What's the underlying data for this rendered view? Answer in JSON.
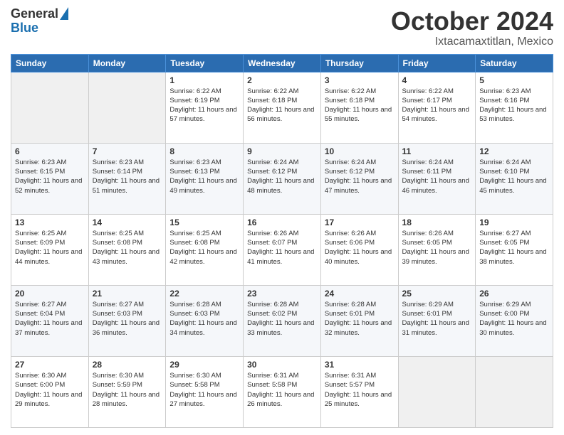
{
  "logo": {
    "general": "General",
    "blue": "Blue"
  },
  "header": {
    "month": "October 2024",
    "location": "Ixtacamaxtitlan, Mexico"
  },
  "weekdays": [
    "Sunday",
    "Monday",
    "Tuesday",
    "Wednesday",
    "Thursday",
    "Friday",
    "Saturday"
  ],
  "weeks": [
    [
      {
        "day": "",
        "sunrise": "",
        "sunset": "",
        "daylight": ""
      },
      {
        "day": "",
        "sunrise": "",
        "sunset": "",
        "daylight": ""
      },
      {
        "day": "1",
        "sunrise": "Sunrise: 6:22 AM",
        "sunset": "Sunset: 6:19 PM",
        "daylight": "Daylight: 11 hours and 57 minutes."
      },
      {
        "day": "2",
        "sunrise": "Sunrise: 6:22 AM",
        "sunset": "Sunset: 6:18 PM",
        "daylight": "Daylight: 11 hours and 56 minutes."
      },
      {
        "day": "3",
        "sunrise": "Sunrise: 6:22 AM",
        "sunset": "Sunset: 6:18 PM",
        "daylight": "Daylight: 11 hours and 55 minutes."
      },
      {
        "day": "4",
        "sunrise": "Sunrise: 6:22 AM",
        "sunset": "Sunset: 6:17 PM",
        "daylight": "Daylight: 11 hours and 54 minutes."
      },
      {
        "day": "5",
        "sunrise": "Sunrise: 6:23 AM",
        "sunset": "Sunset: 6:16 PM",
        "daylight": "Daylight: 11 hours and 53 minutes."
      }
    ],
    [
      {
        "day": "6",
        "sunrise": "Sunrise: 6:23 AM",
        "sunset": "Sunset: 6:15 PM",
        "daylight": "Daylight: 11 hours and 52 minutes."
      },
      {
        "day": "7",
        "sunrise": "Sunrise: 6:23 AM",
        "sunset": "Sunset: 6:14 PM",
        "daylight": "Daylight: 11 hours and 51 minutes."
      },
      {
        "day": "8",
        "sunrise": "Sunrise: 6:23 AM",
        "sunset": "Sunset: 6:13 PM",
        "daylight": "Daylight: 11 hours and 49 minutes."
      },
      {
        "day": "9",
        "sunrise": "Sunrise: 6:24 AM",
        "sunset": "Sunset: 6:12 PM",
        "daylight": "Daylight: 11 hours and 48 minutes."
      },
      {
        "day": "10",
        "sunrise": "Sunrise: 6:24 AM",
        "sunset": "Sunset: 6:12 PM",
        "daylight": "Daylight: 11 hours and 47 minutes."
      },
      {
        "day": "11",
        "sunrise": "Sunrise: 6:24 AM",
        "sunset": "Sunset: 6:11 PM",
        "daylight": "Daylight: 11 hours and 46 minutes."
      },
      {
        "day": "12",
        "sunrise": "Sunrise: 6:24 AM",
        "sunset": "Sunset: 6:10 PM",
        "daylight": "Daylight: 11 hours and 45 minutes."
      }
    ],
    [
      {
        "day": "13",
        "sunrise": "Sunrise: 6:25 AM",
        "sunset": "Sunset: 6:09 PM",
        "daylight": "Daylight: 11 hours and 44 minutes."
      },
      {
        "day": "14",
        "sunrise": "Sunrise: 6:25 AM",
        "sunset": "Sunset: 6:08 PM",
        "daylight": "Daylight: 11 hours and 43 minutes."
      },
      {
        "day": "15",
        "sunrise": "Sunrise: 6:25 AM",
        "sunset": "Sunset: 6:08 PM",
        "daylight": "Daylight: 11 hours and 42 minutes."
      },
      {
        "day": "16",
        "sunrise": "Sunrise: 6:26 AM",
        "sunset": "Sunset: 6:07 PM",
        "daylight": "Daylight: 11 hours and 41 minutes."
      },
      {
        "day": "17",
        "sunrise": "Sunrise: 6:26 AM",
        "sunset": "Sunset: 6:06 PM",
        "daylight": "Daylight: 11 hours and 40 minutes."
      },
      {
        "day": "18",
        "sunrise": "Sunrise: 6:26 AM",
        "sunset": "Sunset: 6:05 PM",
        "daylight": "Daylight: 11 hours and 39 minutes."
      },
      {
        "day": "19",
        "sunrise": "Sunrise: 6:27 AM",
        "sunset": "Sunset: 6:05 PM",
        "daylight": "Daylight: 11 hours and 38 minutes."
      }
    ],
    [
      {
        "day": "20",
        "sunrise": "Sunrise: 6:27 AM",
        "sunset": "Sunset: 6:04 PM",
        "daylight": "Daylight: 11 hours and 37 minutes."
      },
      {
        "day": "21",
        "sunrise": "Sunrise: 6:27 AM",
        "sunset": "Sunset: 6:03 PM",
        "daylight": "Daylight: 11 hours and 36 minutes."
      },
      {
        "day": "22",
        "sunrise": "Sunrise: 6:28 AM",
        "sunset": "Sunset: 6:03 PM",
        "daylight": "Daylight: 11 hours and 34 minutes."
      },
      {
        "day": "23",
        "sunrise": "Sunrise: 6:28 AM",
        "sunset": "Sunset: 6:02 PM",
        "daylight": "Daylight: 11 hours and 33 minutes."
      },
      {
        "day": "24",
        "sunrise": "Sunrise: 6:28 AM",
        "sunset": "Sunset: 6:01 PM",
        "daylight": "Daylight: 11 hours and 32 minutes."
      },
      {
        "day": "25",
        "sunrise": "Sunrise: 6:29 AM",
        "sunset": "Sunset: 6:01 PM",
        "daylight": "Daylight: 11 hours and 31 minutes."
      },
      {
        "day": "26",
        "sunrise": "Sunrise: 6:29 AM",
        "sunset": "Sunset: 6:00 PM",
        "daylight": "Daylight: 11 hours and 30 minutes."
      }
    ],
    [
      {
        "day": "27",
        "sunrise": "Sunrise: 6:30 AM",
        "sunset": "Sunset: 6:00 PM",
        "daylight": "Daylight: 11 hours and 29 minutes."
      },
      {
        "day": "28",
        "sunrise": "Sunrise: 6:30 AM",
        "sunset": "Sunset: 5:59 PM",
        "daylight": "Daylight: 11 hours and 28 minutes."
      },
      {
        "day": "29",
        "sunrise": "Sunrise: 6:30 AM",
        "sunset": "Sunset: 5:58 PM",
        "daylight": "Daylight: 11 hours and 27 minutes."
      },
      {
        "day": "30",
        "sunrise": "Sunrise: 6:31 AM",
        "sunset": "Sunset: 5:58 PM",
        "daylight": "Daylight: 11 hours and 26 minutes."
      },
      {
        "day": "31",
        "sunrise": "Sunrise: 6:31 AM",
        "sunset": "Sunset: 5:57 PM",
        "daylight": "Daylight: 11 hours and 25 minutes."
      },
      {
        "day": "",
        "sunrise": "",
        "sunset": "",
        "daylight": ""
      },
      {
        "day": "",
        "sunrise": "",
        "sunset": "",
        "daylight": ""
      }
    ]
  ]
}
